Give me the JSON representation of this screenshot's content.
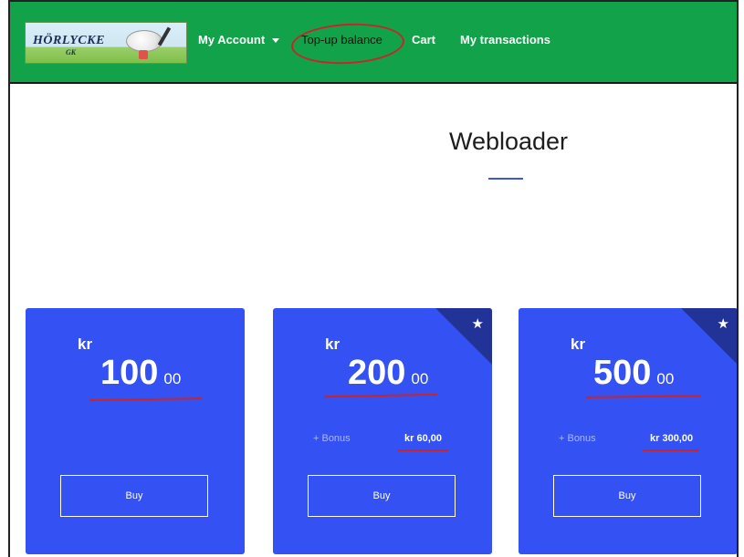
{
  "navbar": {
    "logo_text": "HÖRLYCKE",
    "logo_sub": "GK",
    "items": [
      {
        "label": "My Account"
      },
      {
        "label": "Top-up balance"
      },
      {
        "label": "Cart"
      },
      {
        "label": "My transactions"
      }
    ]
  },
  "page": {
    "title": "Webloader"
  },
  "cards": [
    {
      "currency": "kr",
      "amount": "100",
      "decimals": "00",
      "bonus_label": "",
      "bonus_value": "",
      "featured": false,
      "buy_label": "Buy"
    },
    {
      "currency": "kr",
      "amount": "200",
      "decimals": "00",
      "bonus_label": "+ Bonus",
      "bonus_value": "kr 60,00",
      "featured": true,
      "buy_label": "Buy"
    },
    {
      "currency": "kr",
      "amount": "500",
      "decimals": "00",
      "bonus_label": "+ Bonus",
      "bonus_value": "kr 300,00",
      "featured": true,
      "buy_label": "Buy"
    }
  ],
  "colors": {
    "navbar": "#12a24a",
    "card": "#3451f3",
    "ribbon": "#223398",
    "annotation": "#c8242a"
  },
  "icons": {
    "featured": "star-icon",
    "dropdown": "caret-down-icon"
  }
}
